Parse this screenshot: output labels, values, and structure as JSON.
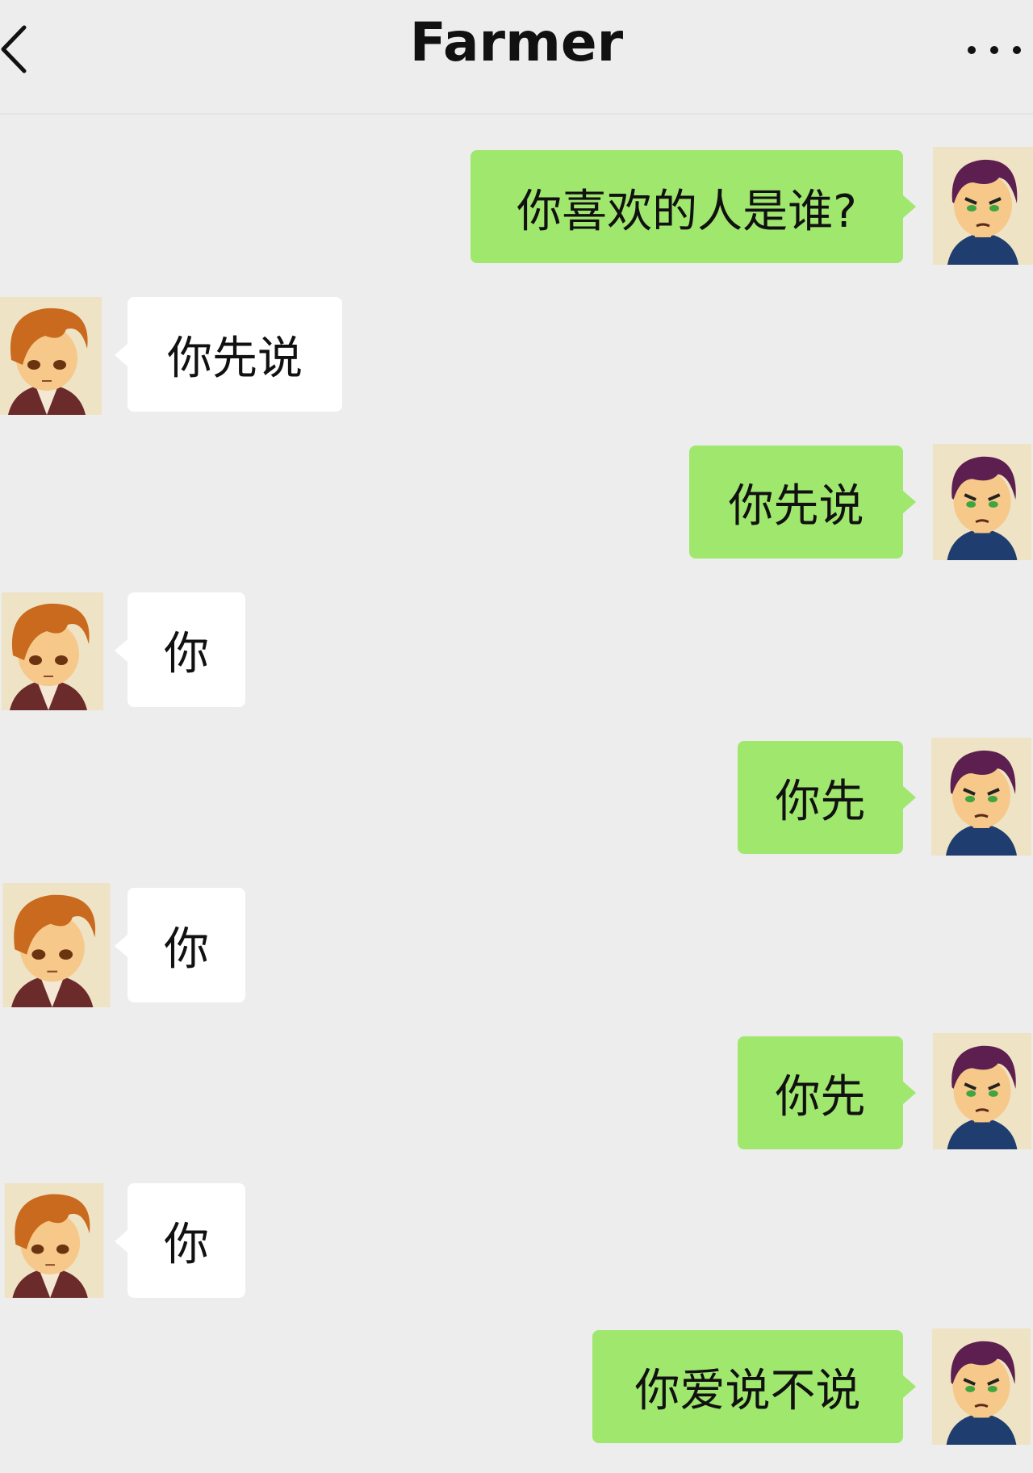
{
  "header": {
    "title": "Farmer",
    "back_icon": "chevron-left-icon",
    "more_icon": "more-horizontal-icon"
  },
  "colors": {
    "background": "#ededed",
    "my_bubble": "#a0e76e",
    "their_bubble": "#ffffff",
    "text": "#111111"
  },
  "messages": [
    {
      "sender": "me",
      "text": "你喜欢的人是谁?"
    },
    {
      "sender": "them",
      "text": "你先说"
    },
    {
      "sender": "me",
      "text": "你先说"
    },
    {
      "sender": "them",
      "text": "你"
    },
    {
      "sender": "me",
      "text": "你先"
    },
    {
      "sender": "them",
      "text": "你"
    },
    {
      "sender": "me",
      "text": "你先"
    },
    {
      "sender": "them",
      "text": "你"
    },
    {
      "sender": "me",
      "text": "你爱说不说"
    }
  ]
}
